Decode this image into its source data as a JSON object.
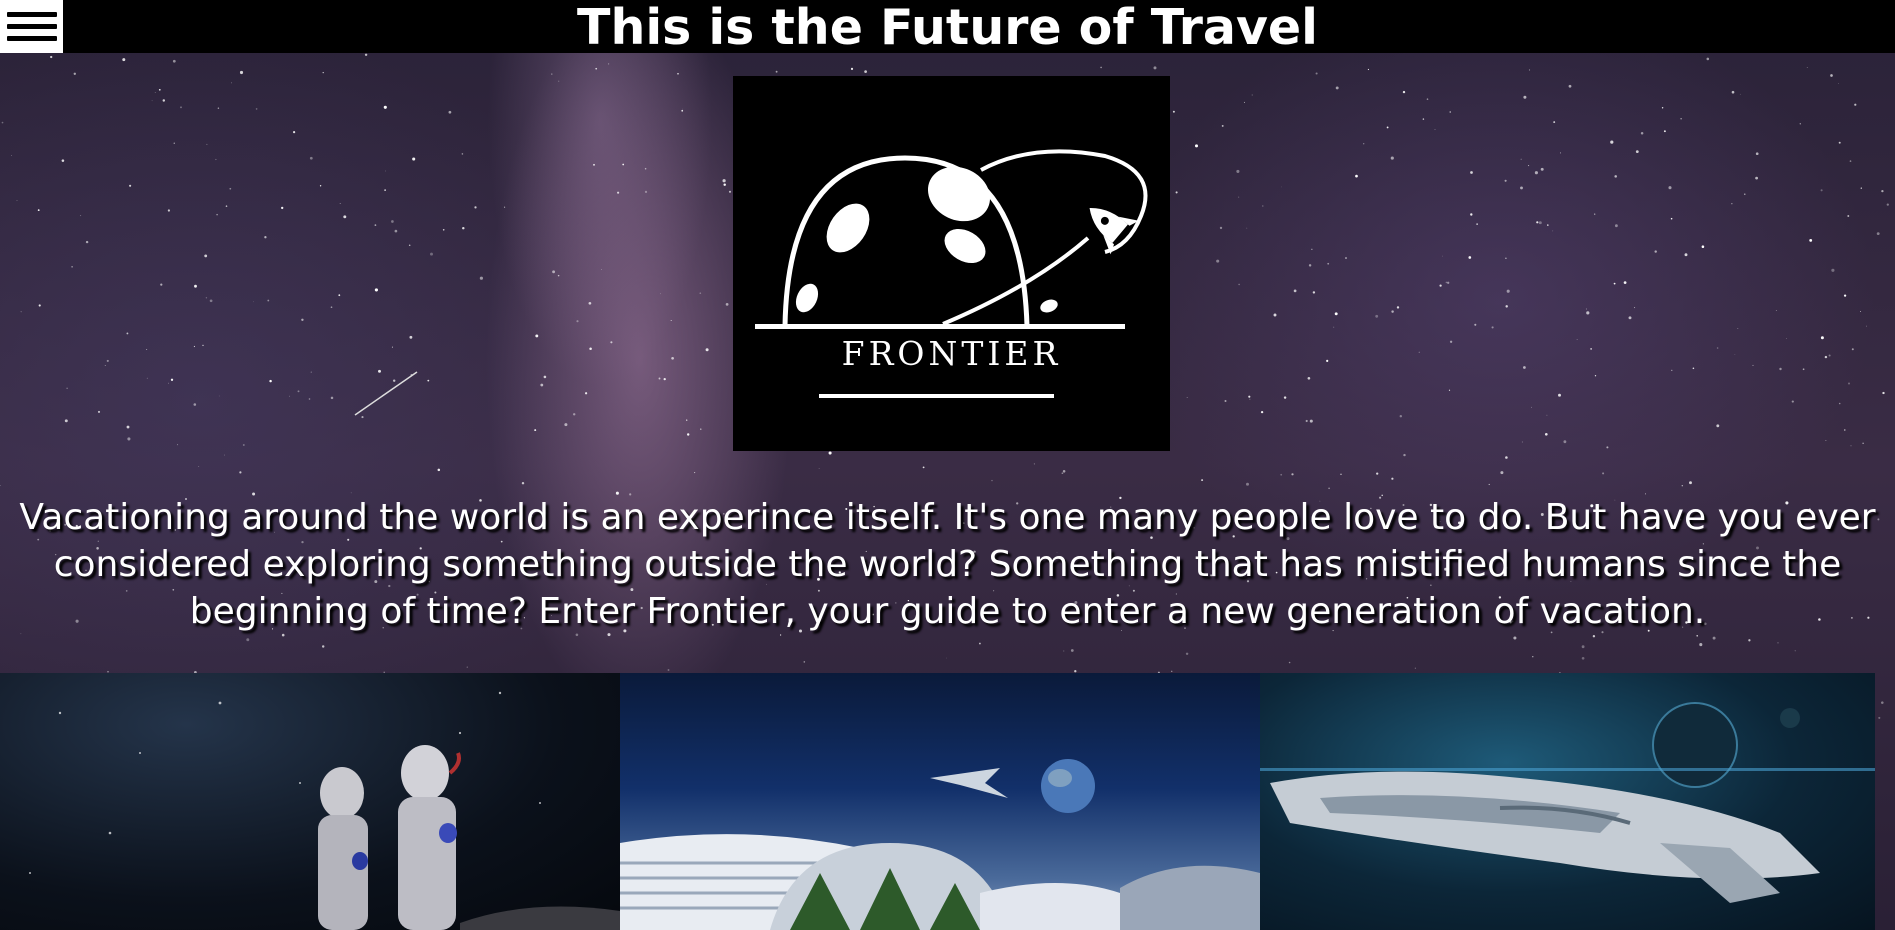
{
  "header": {
    "title": "This is the Future of Travel",
    "menu_icon": "hamburger-menu-icon"
  },
  "logo": {
    "brand": "FRONTIER",
    "icon": "planet-rocket-logo"
  },
  "intro": {
    "text": "Vacationing around the world is an experince itself. It's one many people love to do. But have you ever considered exploring something outside the world? Something that has mistified humans since the beginning of time? Enter Frontier, your guide to enter a new generation of vacation."
  },
  "gallery": {
    "images": [
      "astronauts-image",
      "space-colony-image",
      "spaceship-image"
    ]
  },
  "colors": {
    "topbar": "#000000",
    "text": "#ffffff",
    "logo_bg": "#000000"
  }
}
